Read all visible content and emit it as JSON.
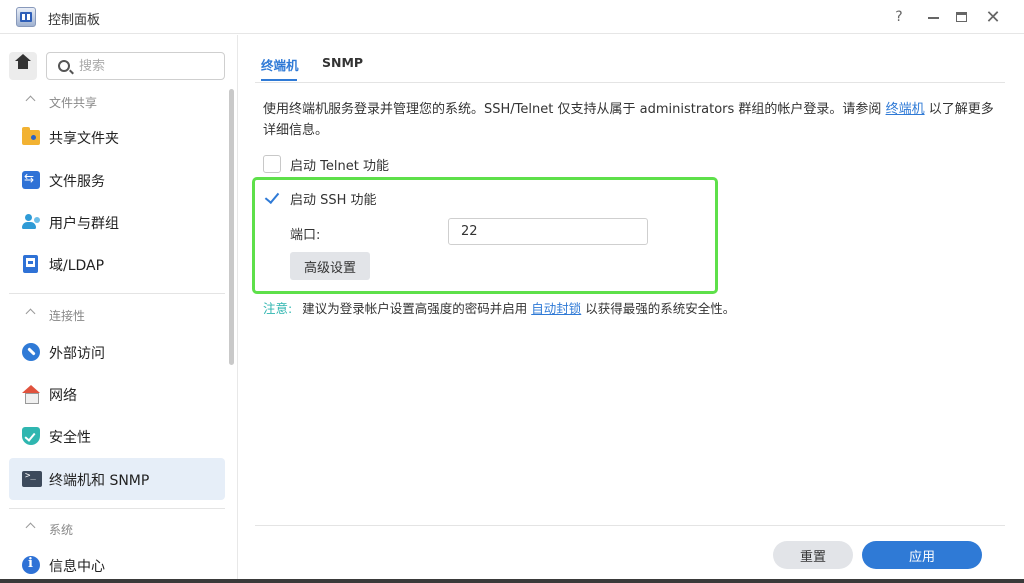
{
  "window": {
    "title": "控制面板",
    "help_label": "?",
    "close_label": "✕"
  },
  "sidebar": {
    "search_placeholder": "搜索",
    "groups": [
      {
        "label": "文件共享"
      },
      {
        "label": "连接性"
      },
      {
        "label": "系统"
      }
    ],
    "items": [
      {
        "label": "共享文件夹",
        "icon": "shared-folder-icon"
      },
      {
        "label": "文件服务",
        "icon": "file-services-icon"
      },
      {
        "label": "用户与群组",
        "icon": "users-groups-icon"
      },
      {
        "label": "域/LDAP",
        "icon": "domain-ldap-icon"
      },
      {
        "label": "外部访问",
        "icon": "external-access-icon"
      },
      {
        "label": "网络",
        "icon": "network-icon"
      },
      {
        "label": "安全性",
        "icon": "security-icon"
      },
      {
        "label": "终端机和 SNMP",
        "icon": "terminal-icon",
        "active": true
      },
      {
        "label": "信息中心",
        "icon": "info-center-icon"
      }
    ]
  },
  "main": {
    "tabs": [
      {
        "label": "终端机",
        "active": true
      },
      {
        "label": "SNMP"
      }
    ],
    "description": {
      "text_before": "使用终端机服务登录并管理您的系统。SSH/Telnet 仅支持从属于 administrators 群组的帐户登录。请参阅 ",
      "link": "终端机",
      "text_after": " 以了解更多详细信息。"
    },
    "telnet_label": "启动 Telnet 功能",
    "telnet_checked": false,
    "ssh_label": "启动 SSH 功能",
    "ssh_checked": true,
    "port_label": "端口:",
    "port_value": "22",
    "advanced_button": "高级设置",
    "note": {
      "label": "注意:",
      "text_before": "建议为登录帐户设置高强度的密码并启用 ",
      "link": "自动封锁",
      "text_after": " 以获得最强的系统安全性。"
    },
    "reset_button": "重置",
    "apply_button": "应用"
  },
  "colors": {
    "accent": "#2f7ad6",
    "highlight": "#5ee04a",
    "note": "#2fb6b0"
  }
}
